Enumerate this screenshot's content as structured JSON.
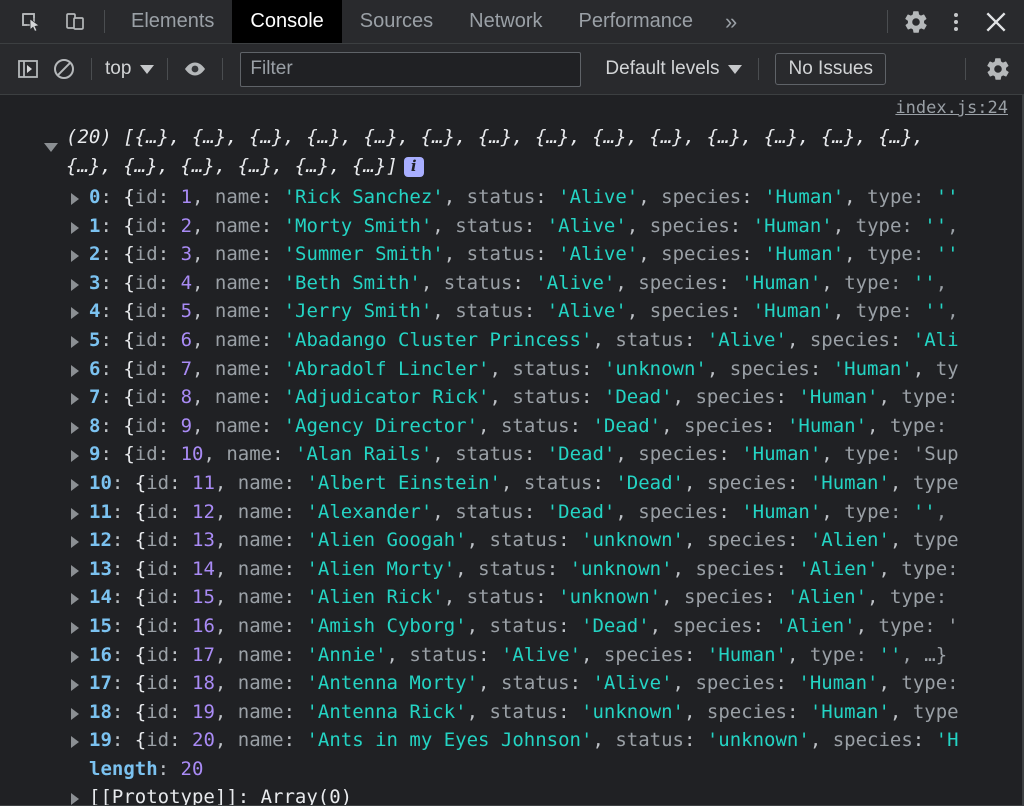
{
  "tabbar": {
    "icons": [
      {
        "name": "inspect-element-icon",
        "label": "Inspect element"
      },
      {
        "name": "device-toolbar-icon",
        "label": "Toggle device toolbar"
      }
    ],
    "tabs": [
      {
        "label": "Elements",
        "active": false
      },
      {
        "label": "Console",
        "active": true
      },
      {
        "label": "Sources",
        "active": false
      },
      {
        "label": "Network",
        "active": false
      },
      {
        "label": "Performance",
        "active": false
      }
    ],
    "more_label": "»",
    "right_icons": [
      {
        "name": "settings-gear-icon",
        "label": "Settings"
      },
      {
        "name": "more-options-kebab-icon",
        "label": "Customize and control DevTools"
      },
      {
        "name": "close-icon",
        "label": "Close DevTools"
      }
    ]
  },
  "filterbar": {
    "sidebar_toggle": "show-console-sidebar-icon",
    "clear_console": "clear-console-icon",
    "context_label": "top",
    "live_expression": "eye-icon",
    "filter_value": "",
    "filter_placeholder": "Filter",
    "levels_label": "Default levels",
    "issues_label": "No Issues",
    "settings_icon": "console-settings-gear-icon"
  },
  "console": {
    "source_link": "index.js:24",
    "array_header": {
      "count": "(20)",
      "open": " [",
      "item": "{…}",
      "sep": ", ",
      "close": "]",
      "total_items": 20,
      "badge": "i"
    },
    "length_key": "length",
    "length_value": "20",
    "prototype_label": "[[Prototype]]: Array(0)",
    "rows": [
      {
        "index": "0",
        "id": "1",
        "name": "Rick Sanchez",
        "status": "Alive",
        "species": "Human",
        "tail": "type: ''"
      },
      {
        "index": "1",
        "id": "2",
        "name": "Morty Smith",
        "status": "Alive",
        "species": "Human",
        "tail": "type: '', "
      },
      {
        "index": "2",
        "id": "3",
        "name": "Summer Smith",
        "status": "Alive",
        "species": "Human",
        "tail": "type: ''"
      },
      {
        "index": "3",
        "id": "4",
        "name": "Beth Smith",
        "status": "Alive",
        "species": "Human",
        "tail": "type: '', "
      },
      {
        "index": "4",
        "id": "5",
        "name": "Jerry Smith",
        "status": "Alive",
        "species": "Human",
        "tail": "type: '', "
      },
      {
        "index": "5",
        "id": "6",
        "name": "Abadango Cluster Princess",
        "status": "Alive",
        "species": "Ali",
        "tail": ""
      },
      {
        "index": "6",
        "id": "7",
        "name": "Abradolf Lincler",
        "status": "unknown",
        "species": "Human",
        "tail": "ty"
      },
      {
        "index": "7",
        "id": "8",
        "name": "Adjudicator Rick",
        "status": "Dead",
        "species": "Human",
        "tail": "type:"
      },
      {
        "index": "8",
        "id": "9",
        "name": "Agency Director",
        "status": "Dead",
        "species": "Human",
        "tail": "type:"
      },
      {
        "index": "9",
        "id": "10",
        "name": "Alan Rails",
        "status": "Dead",
        "species": "Human",
        "tail": "type: 'Sup"
      },
      {
        "index": "10",
        "id": "11",
        "name": "Albert Einstein",
        "status": "Dead",
        "species": "Human",
        "tail": "type"
      },
      {
        "index": "11",
        "id": "12",
        "name": "Alexander",
        "status": "Dead",
        "species": "Human",
        "tail": "type: '', "
      },
      {
        "index": "12",
        "id": "13",
        "name": "Alien Googah",
        "status": "unknown",
        "species": "Alien",
        "tail": "type"
      },
      {
        "index": "13",
        "id": "14",
        "name": "Alien Morty",
        "status": "unknown",
        "species": "Alien",
        "tail": "type:"
      },
      {
        "index": "14",
        "id": "15",
        "name": "Alien Rick",
        "status": "unknown",
        "species": "Alien",
        "tail": "type:"
      },
      {
        "index": "15",
        "id": "16",
        "name": "Amish Cyborg",
        "status": "Dead",
        "species": "Alien",
        "tail": "type: '"
      },
      {
        "index": "16",
        "id": "17",
        "name": "Annie",
        "status": "Alive",
        "species": "Human",
        "tail": "type: '', …}"
      },
      {
        "index": "17",
        "id": "18",
        "name": "Antenna Morty",
        "status": "Alive",
        "species": "Human",
        "tail": "type:"
      },
      {
        "index": "18",
        "id": "19",
        "name": "Antenna Rick",
        "status": "unknown",
        "species": "Human",
        "tail": "type"
      },
      {
        "index": "19",
        "id": "20",
        "name": "Ants in my Eyes Johnson",
        "status": "unknown",
        "species": "H",
        "tail": ""
      }
    ]
  },
  "colors": {
    "panel_bg": "#292a2d",
    "console_bg": "#202124",
    "active_tab_bg": "#000000",
    "string": "#24d4c4",
    "number": "#a98bf5",
    "index": "#7bc2f0",
    "key": "#9aa0a6",
    "badge": "#a8aeff"
  }
}
